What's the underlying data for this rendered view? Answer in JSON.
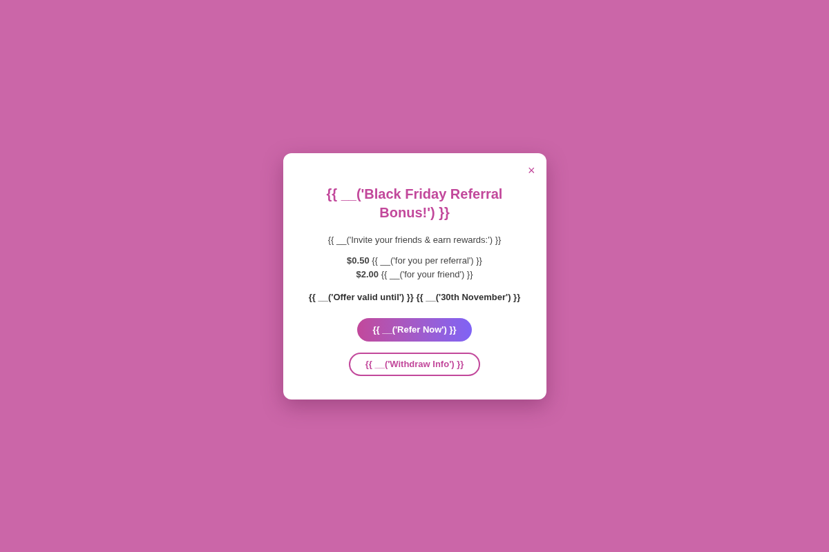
{
  "modal": {
    "close": "×",
    "title": "{{ __('Black Friday Referral Bonus!') }}",
    "intro": "{{ __('Invite your friends & earn rewards:') }}",
    "rewards": [
      "**$0.50** {{ __('for you per referral') }}",
      "**$2.00** {{ __('for your friend') }}"
    ],
    "offer": "{{ __('Offer valid until') }} **{{ __('30th November') }}**",
    "primary_button": "{{ __('Refer Now') }}",
    "secondary_button": "{{ __('Withdraw Info') }}"
  }
}
